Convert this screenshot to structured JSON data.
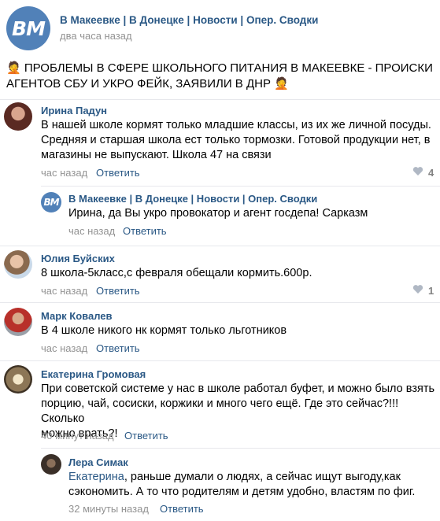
{
  "post": {
    "group_logo": "ВМ",
    "group_name": "В Макеевке | В Донецке | Новости | Опер. Сводки",
    "time": "два часа назад",
    "text_line1": "🤦 ПРОБЛЕМЫ В СФЕРЕ ШКОЛЬНОГО ПИТАНИЯ В МАКЕЕВКЕ - ПРОИСКИ",
    "text_line2": "АГЕНТОВ СБУ И УКРО ФЕЙК, ЗАЯВИЛИ В ДНР 🤦"
  },
  "comments": [
    {
      "author": "Ирина Падун",
      "lines": [
        "В нашей школе кормят только младшие классы, из их же личной посуды.",
        "Средняя и старшая школа ест только тормозки. Готовой продукции нет, в",
        "магазины не выпускают. Школа 47 на связи"
      ],
      "time": "час назад",
      "reply": "Ответить",
      "likes": "4"
    },
    {
      "author": "В Макеевке | В Донецке | Новости | Опер. Сводки",
      "logo": "ВМ",
      "text": "Ирина, да Вы укро провокатор и агент госдепа! Сарказм",
      "time": "час назад",
      "reply": "Ответить"
    },
    {
      "author": "Юлия Буйских",
      "text": "8 школа-5класс,с февраля обещали кормить.600р.",
      "time": "час назад",
      "reply": "Ответить",
      "likes": "1"
    },
    {
      "author": "Марк Ковалев",
      "text": "В 4 школе никого нк кормят только льготников",
      "time": "час назад",
      "reply": "Ответить"
    },
    {
      "author": "Екатерина Громовая",
      "lines": [
        "При советской системе у нас в школе работал буфет, и можно было взять",
        "порцию, чай, сосиски, коржики и много чего ещё. Где это сейчас?!!! Сколько",
        "можно врать?!"
      ],
      "time": "40 минут назад",
      "reply": "Ответить"
    },
    {
      "author": "Лера Симак",
      "mention": "Екатерина",
      "line1_rest": ", раньше думали о людях, а сейчас ищут выгоду,как",
      "line2": "сэкономить. А то что родителям и детям удобно, властям по фиг.",
      "time": "32 минуты назад",
      "reply": "Ответить"
    }
  ],
  "colors": {
    "link": "#2a5885",
    "muted": "#939393",
    "logo_bg": "#5181b8",
    "separator": "#e7e8ec"
  },
  "icons": [
    "heart-icon",
    "facepalm-emoji"
  ]
}
